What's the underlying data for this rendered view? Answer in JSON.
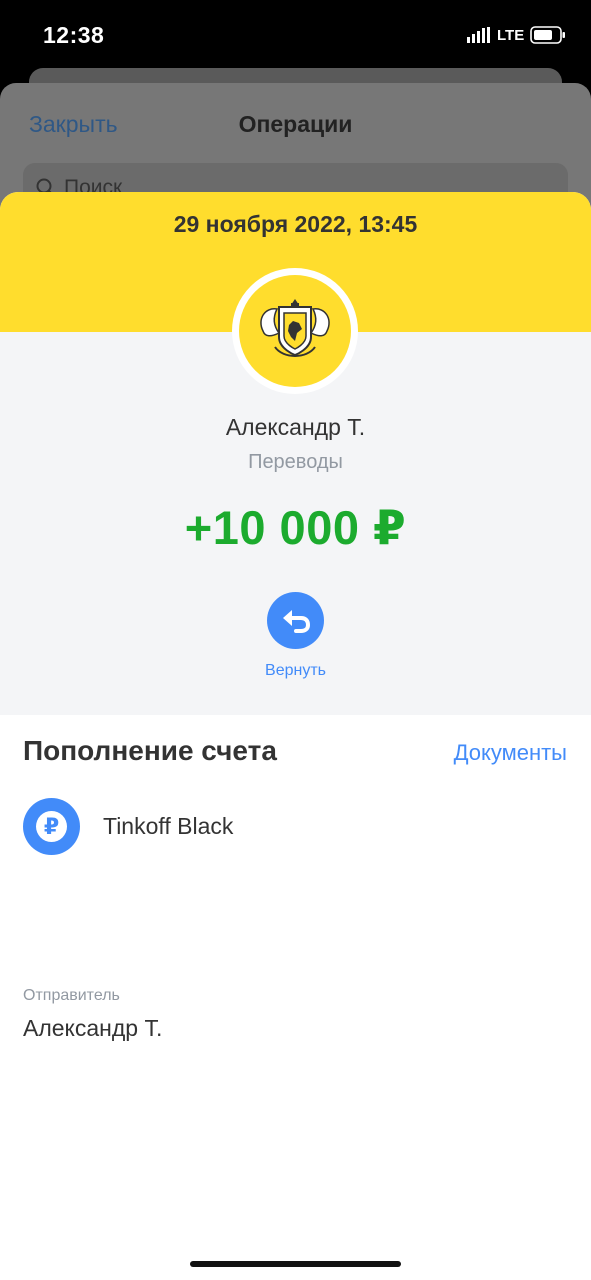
{
  "status_bar": {
    "time": "12:38",
    "network": "LTE",
    "signal_icon": "signal-bars-icon",
    "battery_icon": "battery-icon"
  },
  "operations": {
    "close_label": "Закрыть",
    "title": "Операции",
    "search_placeholder": "Поиск",
    "search_icon": "search-icon"
  },
  "transaction": {
    "date": "29 ноября 2022, 13:45",
    "logo_icon": "bank-logo-icon",
    "counterparty": "Александр Т.",
    "category": "Переводы",
    "amount": "+10 000 ₽",
    "return_icon": "return-arrow-icon",
    "return_label": "Вернуть"
  },
  "details": {
    "title": "Пополнение счета",
    "documents_label": "Документы",
    "account_icon_symbol": "₽",
    "account_icon": "ruble-icon",
    "account_name": "Tinkoff Black",
    "sender_label": "Отправитель",
    "sender_value": "Александр Т."
  },
  "colors": {
    "brand_yellow": "#ffdd2d",
    "accent_blue": "#428bf9",
    "amount_green": "#1cab2e",
    "secondary_text": "#9299a2"
  }
}
